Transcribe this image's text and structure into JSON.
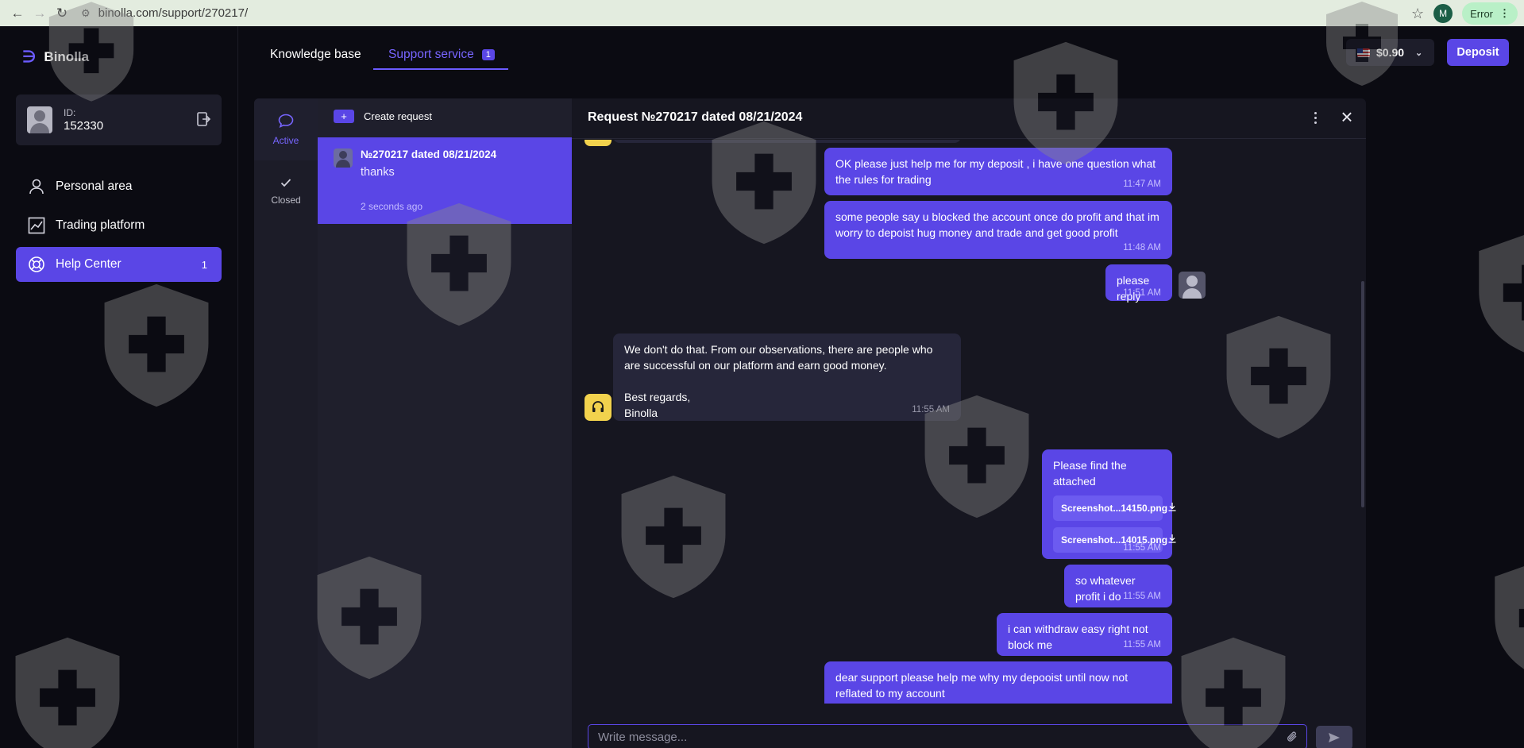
{
  "browser": {
    "url": "binolla.com/support/270217/",
    "profile_initial": "M",
    "error_label": "Error"
  },
  "sidebar": {
    "logo_text": "Binolla",
    "user": {
      "id_label": "ID:",
      "id_value": "152330"
    },
    "menu": [
      {
        "label": "Personal area",
        "icon": "user-icon"
      },
      {
        "label": "Trading platform",
        "icon": "chart-icon"
      },
      {
        "label": "Help Center",
        "icon": "lifebuoy-icon",
        "badge": "1",
        "active": true
      }
    ]
  },
  "topnav": {
    "tabs": [
      {
        "label": "Knowledge base"
      },
      {
        "label": "Support service",
        "badge": "1",
        "active": true
      }
    ],
    "balance": "$0.90",
    "deposit_label": "Deposit"
  },
  "status_tabs": [
    {
      "label": "Active",
      "icon": "chat-bubble-icon",
      "active": true
    },
    {
      "label": "Closed",
      "icon": "check-icon"
    }
  ],
  "requests": {
    "create_label": "Create request",
    "items": [
      {
        "title": "№270217 dated 08/21/2024",
        "last_message": "thanks",
        "time": "2 seconds ago"
      }
    ]
  },
  "chat": {
    "title": "Request №270217 dated 08/21/2024",
    "messages": [
      {
        "from": "user",
        "text": "OK please just help me for my deposit , i have one question what the rules for trading",
        "time": "11:47 AM"
      },
      {
        "from": "user",
        "text": "some people say u blocked the account once do profit and that im worry to depoist hug money and trade and get good profit",
        "time": "11:48 AM"
      },
      {
        "from": "user",
        "text": "please reply",
        "time": "11:51 AM"
      },
      {
        "from": "support",
        "text": "We don't do that. From our observations, there are people who are successful on our platform and earn good money.",
        "text2": "Best regards,",
        "text3": "Binolla",
        "time": "11:55 AM"
      },
      {
        "from": "user",
        "text": "Please find the attached",
        "attachments": [
          "Screenshot...14150.png",
          "Screenshot...14015.png"
        ],
        "time": "11:55 AM"
      },
      {
        "from": "user",
        "text": "so whatever profit i do",
        "time": "11:55 AM"
      },
      {
        "from": "user",
        "text": "i can withdraw easy  right not block me",
        "time": "11:55 AM"
      },
      {
        "from": "user",
        "text": "dear support please help me why my depooist until now not reflated to my account",
        "time": ""
      }
    ],
    "composer_placeholder": "Write message..."
  },
  "colors": {
    "accent": "#5a46e6",
    "background": "#0b0b12",
    "panel": "#161620"
  }
}
